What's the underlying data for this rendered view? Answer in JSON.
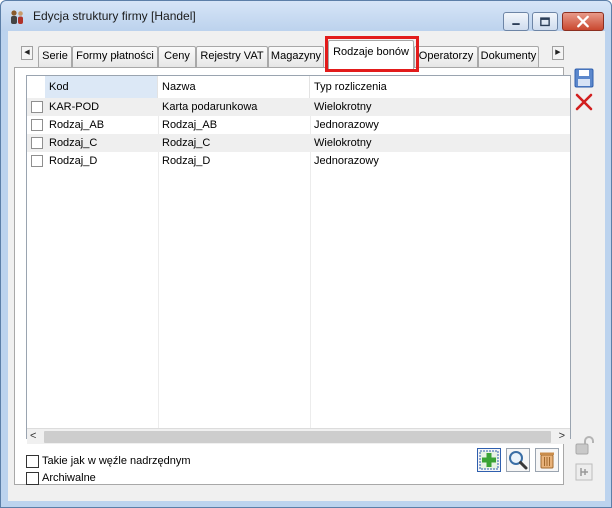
{
  "window": {
    "title": "Edycja struktury firmy [Handel]"
  },
  "tabs": [
    {
      "label": "Serie"
    },
    {
      "label": "Formy płatności"
    },
    {
      "label": "Ceny"
    },
    {
      "label": "Rejestry VAT"
    },
    {
      "label": "Magazyny"
    },
    {
      "label": "Rodzaje bonów",
      "active": true
    },
    {
      "label": "Operatorzy"
    },
    {
      "label": "Dokumenty"
    }
  ],
  "grid": {
    "columns": [
      "Kod",
      "Nazwa",
      "Typ rozliczenia"
    ],
    "rows": [
      {
        "kod": "KAR-POD",
        "nazwa": "Karta podarunkowa",
        "typ": "Wielokrotny"
      },
      {
        "kod": "Rodzaj_AB",
        "nazwa": "Rodzaj_AB",
        "typ": "Jednorazowy"
      },
      {
        "kod": "Rodzaj_C",
        "nazwa": "Rodzaj_C",
        "typ": "Wielokrotny"
      },
      {
        "kod": "Rodzaj_D",
        "nazwa": "Rodzaj_D",
        "typ": "Jednorazowy"
      }
    ]
  },
  "options": {
    "same_as_parent": "Takie jak w węźle nadrzędnym",
    "archived": "Archiwalne"
  },
  "colors": {
    "highlight": "#e21b1b",
    "add_green": "#3aa335",
    "delete_red": "#d21f1f",
    "save_blue": "#2f5fae"
  }
}
